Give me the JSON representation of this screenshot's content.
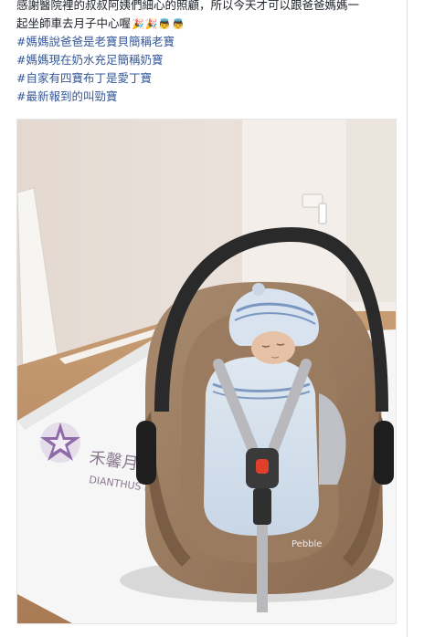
{
  "post": {
    "caption_line_1": "感謝醫院裡的叔叔阿姨們細心的照顧，所以今天才可以跟爸爸媽媽一",
    "caption_line_2": "起坐師車去月子中心喔",
    "caption_emojis": [
      "🎉",
      "🎉",
      "👼",
      "👼"
    ],
    "hashtags": [
      "#媽媽說爸爸是老寶貝簡稱老寶",
      "#媽媽現在奶水充足簡稱奶寶",
      "#自家有四寶布丁是愛丁寶",
      "#最新報到的叫勁寶"
    ]
  },
  "photo": {
    "mat_brand_text_1": "禾馨月",
    "mat_brand_text_2": "DIANTHUS MA",
    "seat_brand_label": "Pebble"
  },
  "colors": {
    "hashtag": "#365899",
    "text": "#1d2129"
  }
}
